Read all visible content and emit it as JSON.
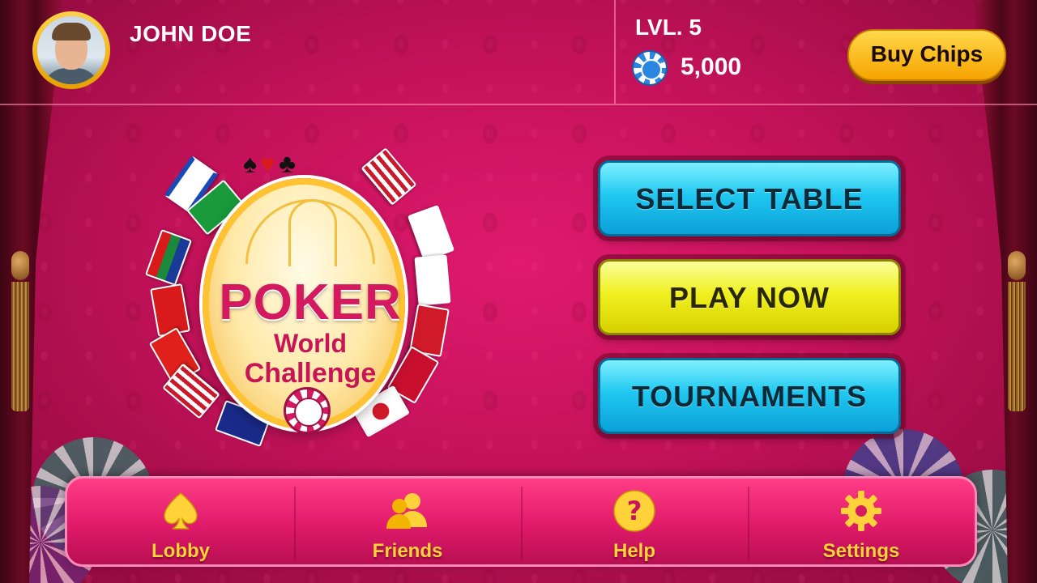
{
  "header": {
    "username": "JOHN DOE",
    "level": "LVL. 5",
    "chips": "5,000",
    "buy_chips_label": "Buy Chips"
  },
  "logo": {
    "title": "POKER",
    "subtitle_line1": "World",
    "subtitle_line2": "Challenge"
  },
  "actions": {
    "select_table": "SELECT TABLE",
    "play_now": "PLAY NOW",
    "tournaments": "TOURNAMENTS"
  },
  "nav": {
    "items": [
      {
        "label": "Lobby",
        "icon": "spade-icon"
      },
      {
        "label": "Friends",
        "icon": "friends-icon"
      },
      {
        "label": "Help",
        "icon": "help-icon"
      },
      {
        "label": "Settings",
        "icon": "gear-icon"
      }
    ]
  },
  "colors": {
    "background": "#c4125a",
    "accent_gold": "#ffd23a",
    "button_blue": "#20c8f0",
    "button_yellow": "#f0f020"
  }
}
